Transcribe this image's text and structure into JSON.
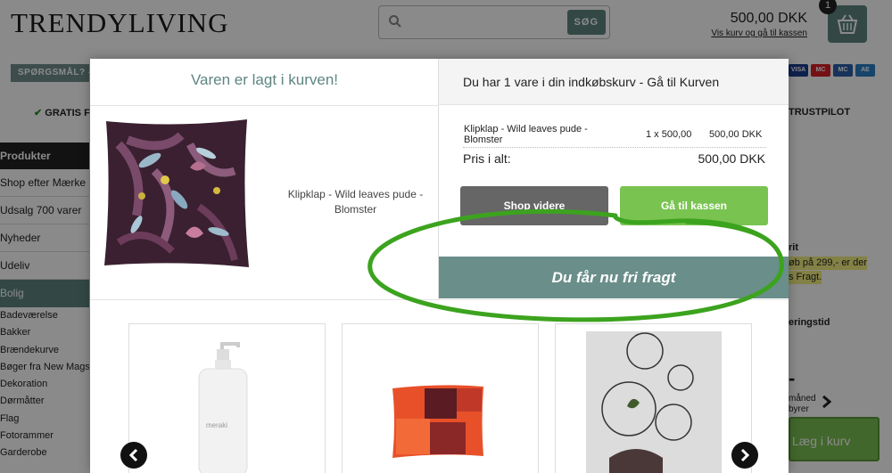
{
  "header": {
    "logo": "TRENDYLIVING",
    "search_button": "SØG",
    "cart_total": "500,00 DKK",
    "cart_link": "Vis kurv og gå til kassen",
    "cart_count": "1"
  },
  "infobar": {
    "label": "SPØRGSMÅL? -"
  },
  "payment_cards": [
    "VISA",
    "MC",
    "MC",
    "AE"
  ],
  "usp": {
    "left": "GRATIS F",
    "right": "TRUSTPILOT"
  },
  "sidebar": {
    "heading": "Produkter",
    "items": [
      {
        "label": "Shop efter Mærke"
      },
      {
        "label": "Udsalg 700 varer"
      },
      {
        "label": "Nyheder"
      },
      {
        "label": "Udeliv"
      }
    ],
    "active": "Bolig",
    "sub_items": [
      {
        "label": "Badeværelse"
      },
      {
        "label": "Bakker"
      },
      {
        "label": "Brændekurve"
      },
      {
        "label": "Bøger fra New Mags"
      },
      {
        "label": "Dekoration"
      },
      {
        "label": "Dørmåtter"
      },
      {
        "label": "Flag"
      },
      {
        "label": "Fotorammer"
      },
      {
        "label": "Garderobe"
      }
    ]
  },
  "right_column": {
    "title_fragment": "rit",
    "highlight_1": "øb på 299,- er der",
    "highlight_2": "s Fragt.",
    "delivery_label": "eringstid",
    "dash": "-",
    "month": "måned",
    "gyr": "byrer",
    "add_to_cart": "Læg i kurv"
  },
  "modal": {
    "added_title": "Varen er lagt i kurven!",
    "product_name": "Klipklap - Wild leaves pude - Blomster",
    "cart_header": "Du har 1 vare i din indkøbskurv - Gå til Kurven",
    "line_item": {
      "name": "Klipklap - Wild leaves pude - Blomster",
      "qty_price": "1 x 500,00",
      "total": "500,00 DKK"
    },
    "total_label": "Pris i alt:",
    "total_value": "500,00 DKK",
    "continue_button": "Shop videre",
    "checkout_button": "Gå til kassen",
    "free_shipping": "Du får nu fri fragt"
  },
  "colors": {
    "brand_teal": "#5e8580",
    "green": "#79c351",
    "annotation_green": "#3ca31e"
  }
}
